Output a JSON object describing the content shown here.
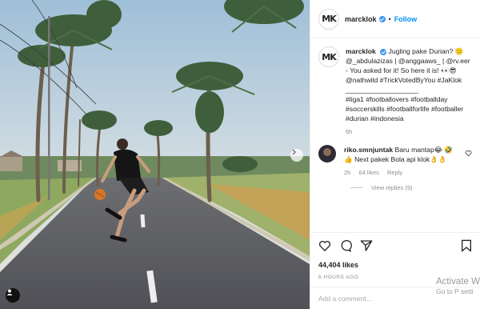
{
  "post": {
    "username": "marcklok",
    "follow_label": "Follow",
    "separator": "•",
    "avatar_text": "MK",
    "caption_text": "Jugling pake Durian? 🙂 @_abdulazizas | @anggaaws_ | @rv.eer - You asked for it! So here it is! 👀😎 @nathwild #TrickVotedByYou #JaKlok",
    "caption_divider": "___________________",
    "caption_tags": "#liga1 #footballovers #footballday #soccerskills #footballforlife #footballer #durian #indonesia",
    "caption_age": "6h"
  },
  "comment": {
    "username": "riko.smnjuntak",
    "text": "Baru mantap😂 🤣👍 Next pakek Bola api klok👌👌",
    "age": "2h",
    "likes": "64 likes",
    "reply_label": "Reply",
    "view_replies": "View replies (9)"
  },
  "stats": {
    "likes": "44,404 likes",
    "posted": "6 HOURS AGO"
  },
  "input": {
    "placeholder": "Add a comment..."
  },
  "watermark": {
    "line1": "Activate Wi",
    "line2": "Go to P   setti"
  },
  "colors": {
    "link": "#00376b",
    "follow": "#0095f6",
    "verified": "#3897f0"
  }
}
